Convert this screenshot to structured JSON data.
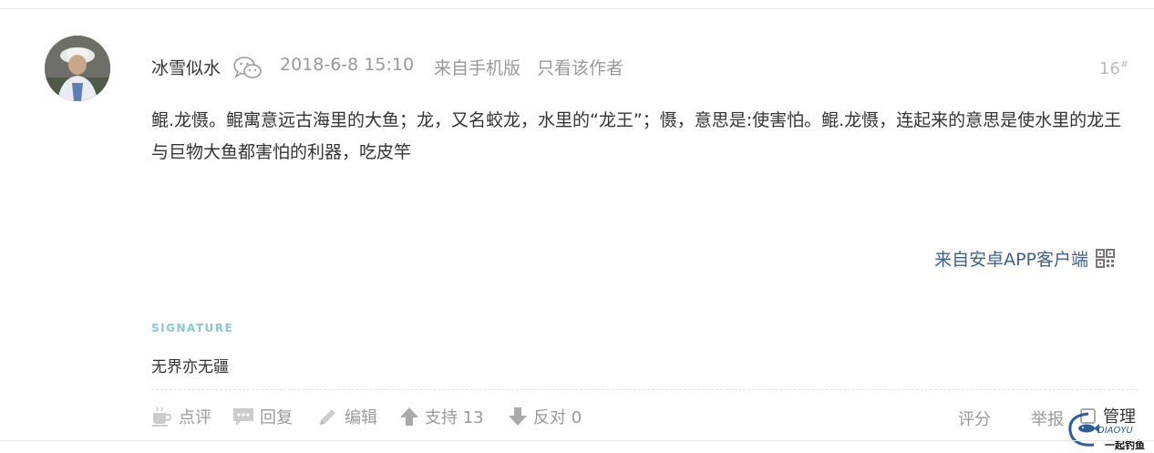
{
  "post": {
    "author": "冰雪似水",
    "time": "2018-6-8 15:10",
    "from_mobile": "来自手机版",
    "only_author": "只看该作者",
    "floor": "16",
    "floor_mark": "#",
    "content": "鲲.龙慑。鲲寓意远古海里的大鱼；龙，又名蛟龙，水里的“龙王”；慑，意思是:使害怕。鲲.龙慑，连起来的意思是使水里的龙王与巨物大鱼都害怕的利器，吃皮竿",
    "app_source": "来自安卓APP客户端",
    "signature_label": "SIGNATURE",
    "signature": "无界亦无疆"
  },
  "actions": {
    "comment": "点评",
    "reply": "回复",
    "edit": "编辑",
    "support": "支持 13",
    "oppose": "反对 0",
    "rate": "评分",
    "report": "举报",
    "manage": "管理"
  },
  "watermark": {
    "brand": "DIAOYU",
    "tagline": "一起钓鱼"
  },
  "colors": {
    "link_blue": "#3e6194",
    "signature_cyan": "#83c8df",
    "muted_gray": "#999999"
  }
}
